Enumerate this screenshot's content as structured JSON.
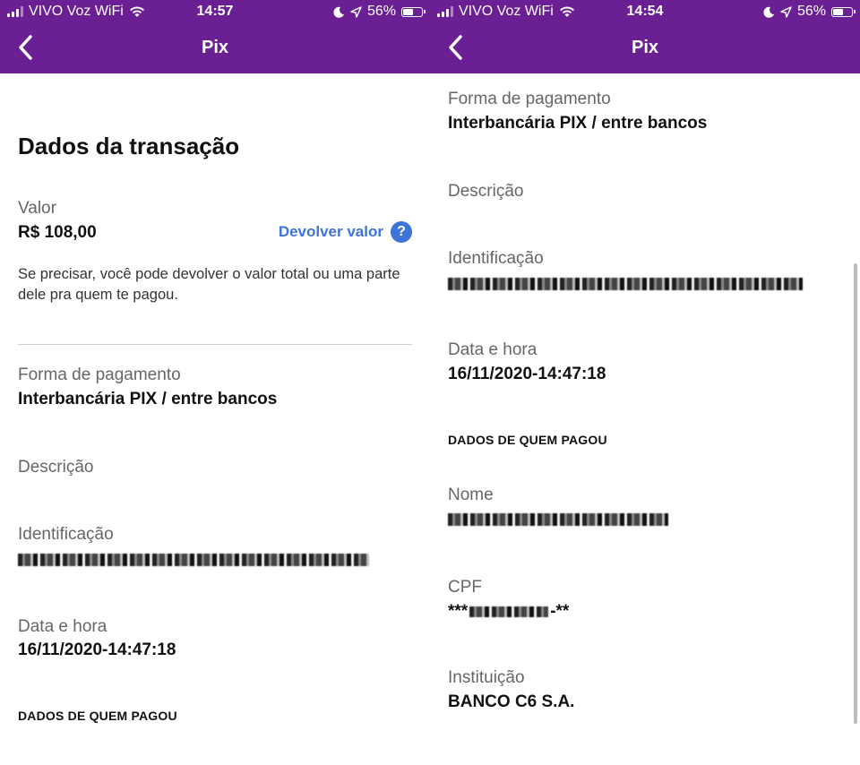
{
  "left": {
    "status": {
      "carrier": "VIVO Voz WiFi",
      "time": "14:57",
      "battery": "56%"
    },
    "nav": {
      "title": "Pix"
    },
    "heading": "Dados da transação",
    "valor": {
      "label": "Valor",
      "value": "R$ 108,00",
      "action": "Devolver valor",
      "help": "?"
    },
    "helper": "Se precisar, você pode devolver o valor total ou uma parte dele pra quem te pagou.",
    "forma": {
      "label": "Forma de pagamento",
      "value": "Interbancária PIX / entre bancos"
    },
    "descricao": {
      "label": "Descrição"
    },
    "identificacao": {
      "label": "Identificação"
    },
    "data_hora": {
      "label": "Data e hora",
      "value": "16/11/2020-14:47:18"
    },
    "section": "DADOS DE QUEM PAGOU"
  },
  "right": {
    "status": {
      "carrier": "VIVO Voz WiFi",
      "time": "14:54",
      "battery": "56%"
    },
    "nav": {
      "title": "Pix"
    },
    "forma": {
      "label": "Forma de pagamento",
      "value": "Interbancária PIX / entre bancos"
    },
    "descricao": {
      "label": "Descrição"
    },
    "identificacao": {
      "label": "Identificação"
    },
    "data_hora": {
      "label": "Data e hora",
      "value": "16/11/2020-14:47:18"
    },
    "section": "DADOS DE QUEM PAGOU",
    "nome": {
      "label": "Nome"
    },
    "cpf": {
      "label": "CPF",
      "prefix": "***",
      "suffix": "-**"
    },
    "instituicao": {
      "label": "Instituição",
      "value": "BANCO C6 S.A."
    }
  },
  "colors": {
    "brand": "#6a1f92",
    "link": "#3d74d8"
  },
  "icons": [
    "signal-icon",
    "wifi-icon",
    "moon-icon",
    "location-arrow-icon",
    "battery-icon",
    "back-chevron-icon",
    "help-icon"
  ]
}
